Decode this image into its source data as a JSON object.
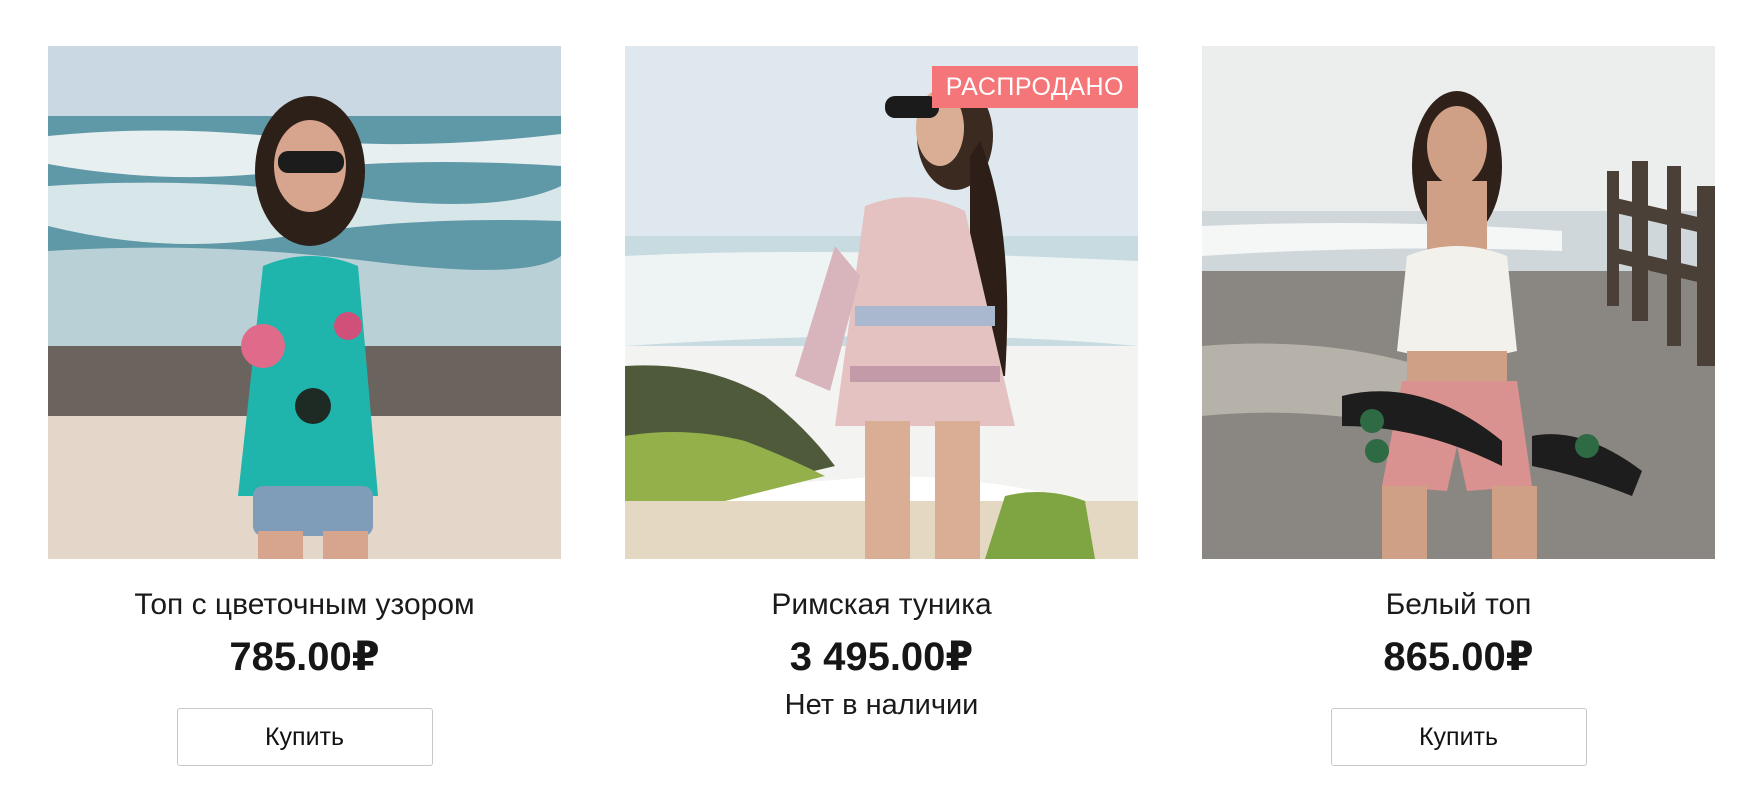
{
  "products": [
    {
      "image_desc": "woman in floral turquoise top on beach",
      "title": "Топ с цветочным узором",
      "price": "785.00₽",
      "buy_label": "Купить"
    },
    {
      "image_desc": "woman in patterned romper on beach",
      "badge": "РАСПРОДАНО",
      "title": "Римская туника",
      "price": "3 495.00₽",
      "stock_status": "Нет в наличии"
    },
    {
      "image_desc": "woman in white crochet top holding skateboard",
      "title": "Белый топ",
      "price": "865.00₽",
      "buy_label": "Купить"
    }
  ],
  "colors": {
    "badge_bg": "#f47678",
    "text": "#161616",
    "button_border": "#c8c8c8"
  }
}
